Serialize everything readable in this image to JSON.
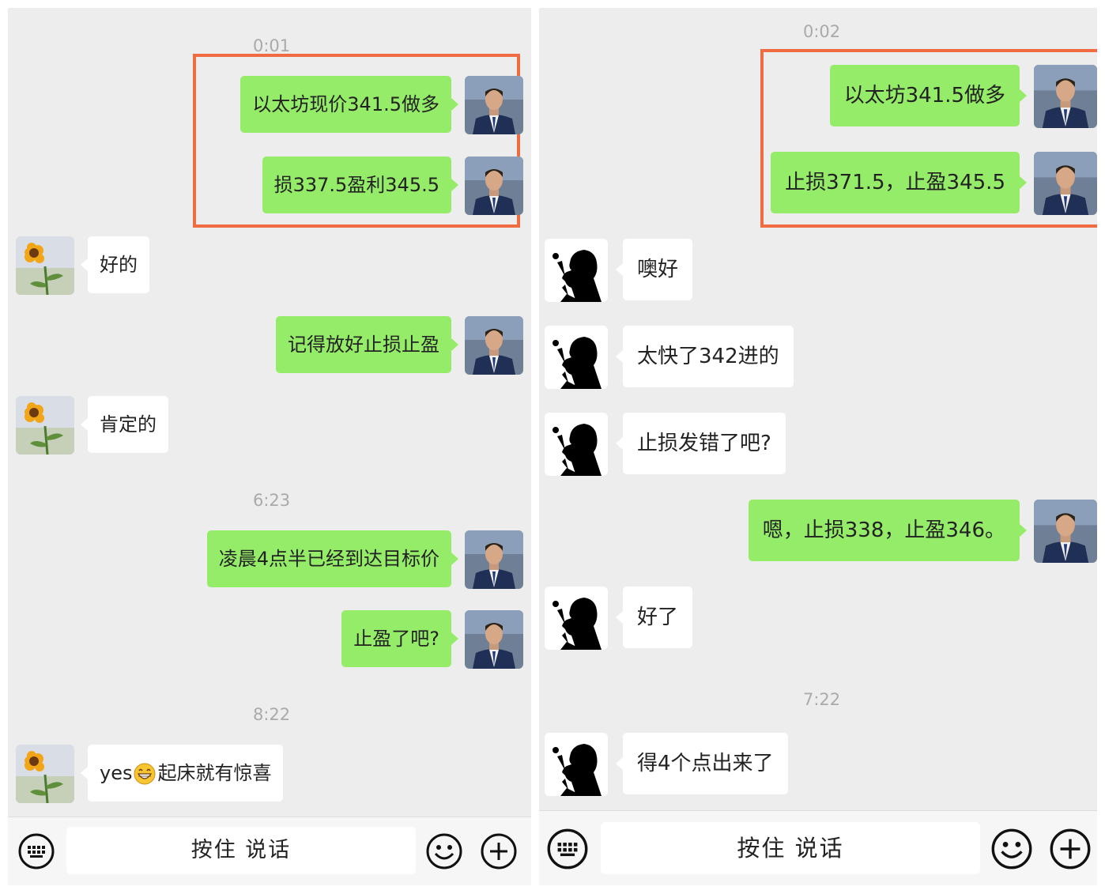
{
  "left": {
    "timestamps": [
      "0:01",
      "6:23",
      "8:22"
    ],
    "messages": {
      "m1": "以太坊现价341.5做多",
      "m2": "损337.5盈利345.5",
      "m3": "好的",
      "m4": "记得放好止损止盈",
      "m5": "肯定的",
      "m6": "凌晨4点半已经到达目标价",
      "m7": "止盈了吧?",
      "m8_prefix": "yes",
      "m8_suffix": "起床就有惊喜"
    },
    "talk_button": "按住 说话"
  },
  "right": {
    "timestamps": [
      "0:02",
      "7:22"
    ],
    "messages": {
      "m1": "以太坊341.5做多",
      "m2": "止损371.5，止盈345.5",
      "m3": "噢好",
      "m4": "太快了342进的",
      "m5": "止损发错了吧?",
      "m6": "嗯，止损338，止盈346。",
      "m7": "好了",
      "m8": "得4个点出来了"
    },
    "talk_button": "按住 说话"
  },
  "icons": {
    "keyboard": "keyboard-icon",
    "emoji": "smiley-face-icon",
    "plus": "plus-icon",
    "grin": "grinning-emoji-icon"
  },
  "colors": {
    "outgoing_bubble": "#95ec69",
    "incoming_bubble": "#ffffff",
    "chat_background": "#ededed",
    "highlight": "#ef6c43",
    "timestamp": "#aaaaaa"
  }
}
